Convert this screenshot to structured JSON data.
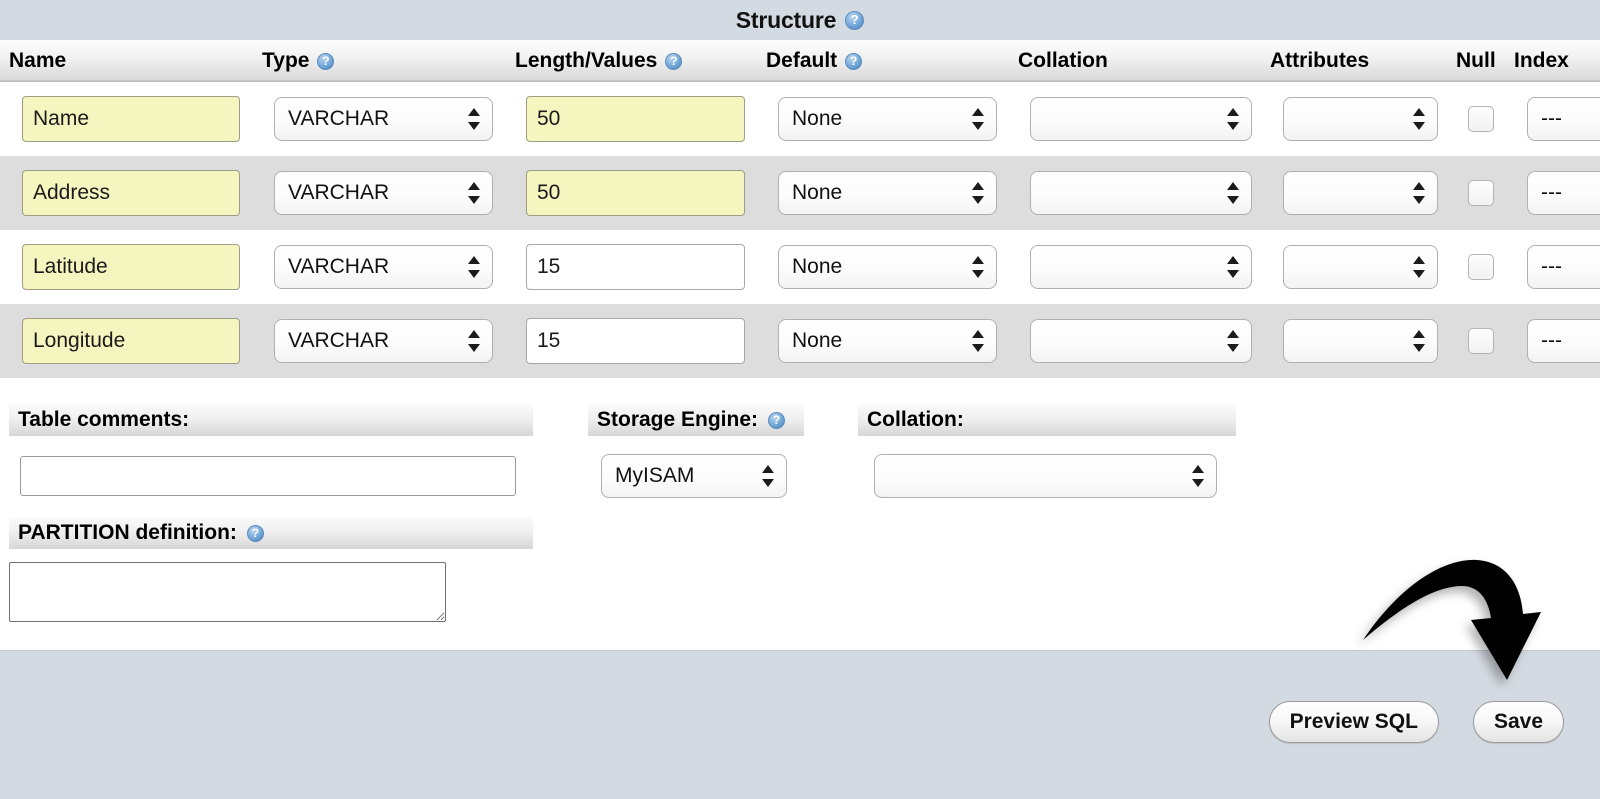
{
  "page": {
    "structure_title": "Structure",
    "help_icon": "help-question-icon"
  },
  "table": {
    "columns": [
      {
        "label": "Name",
        "has_help": false
      },
      {
        "label": "Type",
        "has_help": true
      },
      {
        "label": "Length/Values",
        "has_help": true
      },
      {
        "label": "Default",
        "has_help": true
      },
      {
        "label": "Collation",
        "has_help": false
      },
      {
        "label": "Attributes",
        "has_help": false
      },
      {
        "label": "Null",
        "has_help": false
      },
      {
        "label": "Index",
        "has_help": false
      }
    ],
    "rows": [
      {
        "name": "Name",
        "type": "VARCHAR",
        "length": "50",
        "length_highlighted": true,
        "default": "None",
        "collation": "",
        "attributes": "",
        "null_checked": false,
        "index": "---"
      },
      {
        "name": "Address",
        "type": "VARCHAR",
        "length": "50",
        "length_highlighted": true,
        "default": "None",
        "collation": "",
        "attributes": "",
        "null_checked": false,
        "index": "---"
      },
      {
        "name": "Latitude",
        "type": "VARCHAR",
        "length": "15",
        "length_highlighted": false,
        "default": "None",
        "collation": "",
        "attributes": "",
        "null_checked": false,
        "index": "---"
      },
      {
        "name": "Longitude",
        "type": "VARCHAR",
        "length": "15",
        "length_highlighted": false,
        "default": "None",
        "collation": "",
        "attributes": "",
        "null_checked": false,
        "index": "---"
      }
    ]
  },
  "form": {
    "table_comments_label": "Table comments:",
    "table_comments_value": "",
    "partition_label": "PARTITION definition:",
    "partition_value": "",
    "storage_engine_label": "Storage Engine:",
    "storage_engine_value": "MyISAM",
    "collation_label": "Collation:",
    "collation_value": ""
  },
  "actions": {
    "preview_sql_label": "Preview SQL",
    "save_label": "Save"
  },
  "annotation": {
    "arrow": "curved-down-arrow",
    "points_to": "Save"
  },
  "colors": {
    "strip_bg": "#d4dae1",
    "row_even_bg": "#dddddd",
    "highlight_yellow": "#f5f5c0",
    "help_blue": "#5e95c9"
  }
}
